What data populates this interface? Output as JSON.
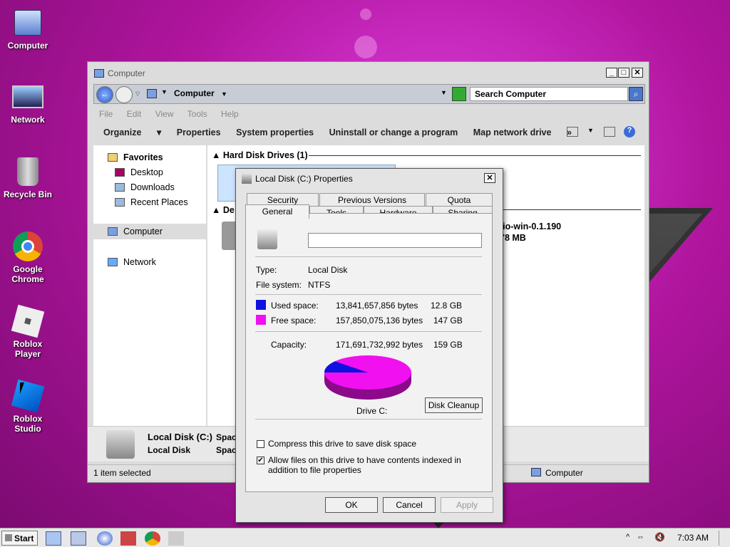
{
  "desktop": {
    "icons": [
      {
        "label": "Computer"
      },
      {
        "label": "Network"
      },
      {
        "label": "Recycle Bin"
      },
      {
        "label": "Google Chrome"
      },
      {
        "label": "Roblox Player"
      },
      {
        "label": "Roblox Studio"
      }
    ]
  },
  "explorer": {
    "title": "Computer",
    "address": "Computer",
    "search_placeholder": "Search Computer",
    "menu": [
      "File",
      "Edit",
      "View",
      "Tools",
      "Help"
    ],
    "toolbar": [
      "Organize",
      "Properties",
      "System properties",
      "Uninstall or change a program",
      "Map network drive"
    ],
    "toolbar_more": "»",
    "nav": {
      "favorites": "Favorites",
      "desktop": "Desktop",
      "downloads": "Downloads",
      "recent": "Recent Places",
      "computer": "Computer",
      "network": "Network"
    },
    "section_hdd": "Hard Disk Drives (1)",
    "section_dev": "De",
    "device_name": "tio-win-0.1.190",
    "device_size": "78 MB",
    "details": {
      "name": "Local Disk (C:)",
      "type": "Local Disk",
      "space1": "Spac",
      "space2": "Spac"
    },
    "status_left": "1 item selected",
    "status_right": "Computer"
  },
  "dialog": {
    "title": "Local Disk (C:) Properties",
    "tabs_top": [
      "Security",
      "Previous Versions",
      "Quota"
    ],
    "tabs_bottom": [
      "General",
      "Tools",
      "Hardware",
      "Sharing"
    ],
    "type_label": "Type:",
    "type_value": "Local Disk",
    "fs_label": "File system:",
    "fs_value": "NTFS",
    "used_label": "Used space:",
    "used_bytes": "13,841,657,856 bytes",
    "used_gb": "12.8 GB",
    "free_label": "Free space:",
    "free_bytes": "157,850,075,136 bytes",
    "free_gb": "147 GB",
    "cap_label": "Capacity:",
    "cap_bytes": "171,691,732,992 bytes",
    "cap_gb": "159 GB",
    "drive_label": "Drive C:",
    "cleanup": "Disk Cleanup",
    "compress": "Compress this drive to save disk space",
    "index": "Allow files on this drive to have contents indexed in addition to file properties",
    "ok": "OK",
    "cancel": "Cancel",
    "apply": "Apply",
    "used_color": "#1010e0",
    "free_color": "#f010f0",
    "used_fraction": 0.081
  },
  "taskbar": {
    "start": "Start",
    "clock": "7:03 AM"
  }
}
